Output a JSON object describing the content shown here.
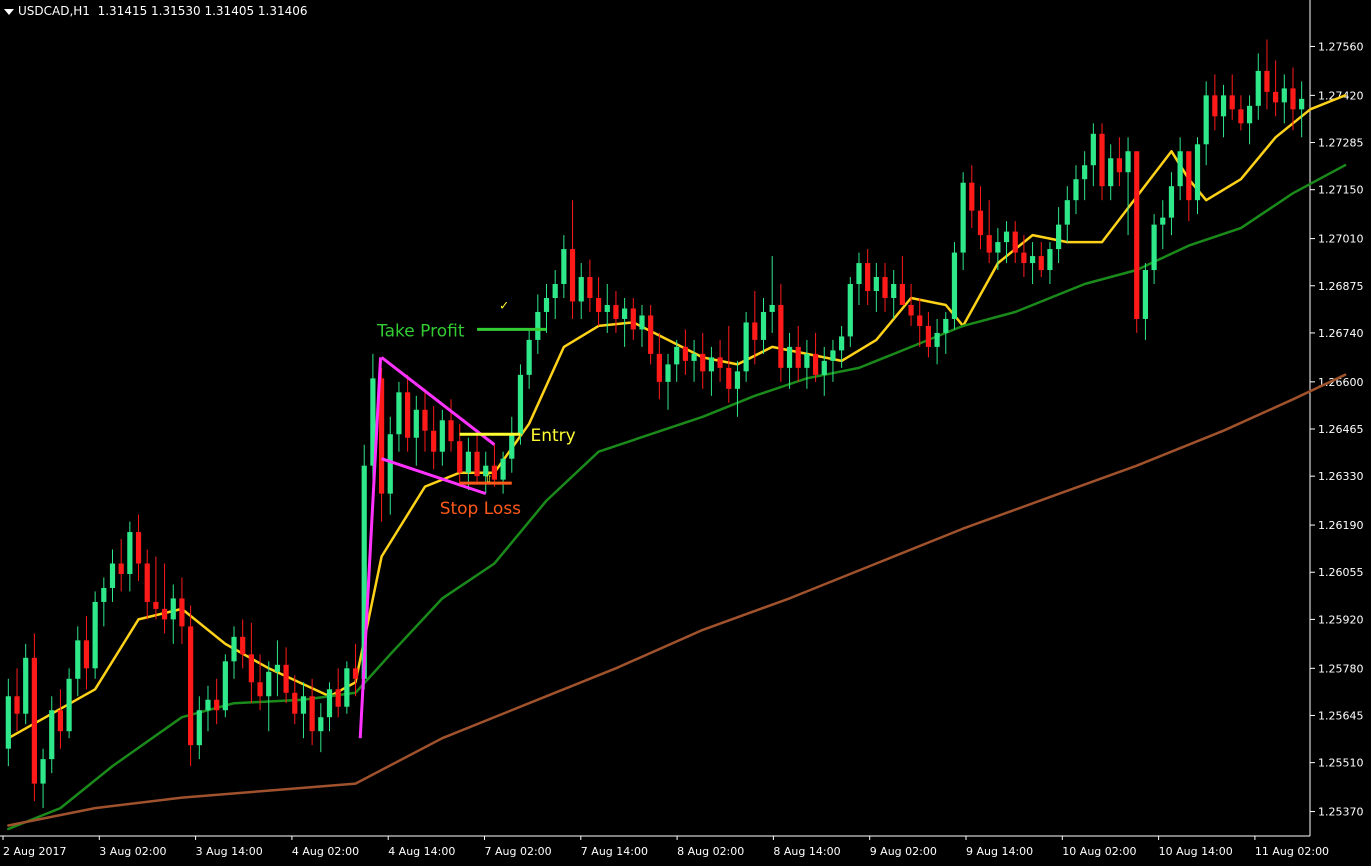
{
  "header": {
    "symbol": "USDCAD,H1",
    "ohlc": "1.31415 1.31530 1.31405 1.31406"
  },
  "colors": {
    "background": "#000000",
    "bull": "#2ee88a",
    "bear": "#ff1a1a",
    "ma_fast": "#ffd21a",
    "ma_mid": "#1a8a1a",
    "ma_slow": "#a0522d",
    "pattern": "#ff33ff",
    "take_profit": "#33cc33",
    "entry": "#ffff33",
    "stop_loss": "#ff5a1a",
    "axis": "#ffffff"
  },
  "annotations": {
    "take_profit_label": "Take Profit",
    "entry_label": "Entry",
    "stop_loss_label": "Stop Loss",
    "check_mark": "✓",
    "arrow_mark": "⇧"
  },
  "chart_data": {
    "type": "candlestick",
    "title": "",
    "ylim": [
      1.253,
      1.2763
    ],
    "y_ticks": [
      "1.27560",
      "1.27420",
      "1.27285",
      "1.27150",
      "1.27010",
      "1.26875",
      "1.26740",
      "1.26600",
      "1.26465",
      "1.26330",
      "1.26190",
      "1.26055",
      "1.25920",
      "1.25780",
      "1.25645",
      "1.25510",
      "1.25370"
    ],
    "x_ticks": [
      "2 Aug 2017",
      "3 Aug 02:00",
      "3 Aug 14:00",
      "4 Aug 02:00",
      "4 Aug 14:00",
      "7 Aug 02:00",
      "7 Aug 14:00",
      "8 Aug 02:00",
      "8 Aug 14:00",
      "9 Aug 02:00",
      "9 Aug 14:00",
      "10 Aug 02:00",
      "10 Aug 14:00",
      "11 Aug 02:00"
    ],
    "candles": [
      [
        1.2555,
        1.2575,
        1.255,
        1.257
      ],
      [
        1.257,
        1.2578,
        1.256,
        1.2565
      ],
      [
        1.2565,
        1.2585,
        1.2562,
        1.2581
      ],
      [
        1.2581,
        1.2588,
        1.254,
        1.2545
      ],
      [
        1.2545,
        1.2555,
        1.2538,
        1.2552
      ],
      [
        1.2552,
        1.257,
        1.2548,
        1.2566
      ],
      [
        1.2566,
        1.2572,
        1.2555,
        1.256
      ],
      [
        1.256,
        1.2578,
        1.2558,
        1.2575
      ],
      [
        1.2575,
        1.259,
        1.257,
        1.2586
      ],
      [
        1.2586,
        1.2593,
        1.2572,
        1.2578
      ],
      [
        1.2578,
        1.26,
        1.2575,
        1.2597
      ],
      [
        1.2597,
        1.2604,
        1.259,
        1.2601
      ],
      [
        1.2601,
        1.2612,
        1.2597,
        1.2608
      ],
      [
        1.2608,
        1.2615,
        1.26,
        1.2605
      ],
      [
        1.2605,
        1.262,
        1.26,
        1.2617
      ],
      [
        1.2617,
        1.2622,
        1.2603,
        1.2608
      ],
      [
        1.2608,
        1.2612,
        1.2592,
        1.2597
      ],
      [
        1.2597,
        1.261,
        1.2592,
        1.2595
      ],
      [
        1.2595,
        1.2608,
        1.2588,
        1.2592
      ],
      [
        1.2592,
        1.2602,
        1.2585,
        1.2598
      ],
      [
        1.2598,
        1.2604,
        1.2585,
        1.259
      ],
      [
        1.259,
        1.2596,
        1.255,
        1.2556
      ],
      [
        1.2556,
        1.257,
        1.2552,
        1.2566
      ],
      [
        1.2566,
        1.2573,
        1.256,
        1.2569
      ],
      [
        1.2569,
        1.2575,
        1.2562,
        1.2566
      ],
      [
        1.2566,
        1.2582,
        1.2564,
        1.258
      ],
      [
        1.258,
        1.259,
        1.2575,
        1.2587
      ],
      [
        1.2587,
        1.2592,
        1.2578,
        1.2582
      ],
      [
        1.2582,
        1.2591,
        1.2568,
        1.2574
      ],
      [
        1.2574,
        1.2582,
        1.2566,
        1.257
      ],
      [
        1.257,
        1.258,
        1.256,
        1.2577
      ],
      [
        1.2577,
        1.2586,
        1.257,
        1.2579
      ],
      [
        1.2579,
        1.2584,
        1.2568,
        1.2571
      ],
      [
        1.2571,
        1.2576,
        1.2562,
        1.2565
      ],
      [
        1.2565,
        1.2574,
        1.2558,
        1.257
      ],
      [
        1.257,
        1.2575,
        1.2556,
        1.256
      ],
      [
        1.256,
        1.2568,
        1.2554,
        1.2564
      ],
      [
        1.2564,
        1.2574,
        1.256,
        1.2572
      ],
      [
        1.2572,
        1.2578,
        1.2564,
        1.2567
      ],
      [
        1.2567,
        1.258,
        1.2565,
        1.2578
      ],
      [
        1.2578,
        1.2585,
        1.257,
        1.2575
      ],
      [
        1.2575,
        1.2642,
        1.2572,
        1.2636
      ],
      [
        1.2636,
        1.2668,
        1.2632,
        1.2661
      ],
      [
        1.2661,
        1.2664,
        1.262,
        1.2628
      ],
      [
        1.2628,
        1.265,
        1.2622,
        1.2645
      ],
      [
        1.2645,
        1.266,
        1.264,
        1.2657
      ],
      [
        1.2657,
        1.2662,
        1.264,
        1.2644
      ],
      [
        1.2644,
        1.2656,
        1.2636,
        1.2652
      ],
      [
        1.2652,
        1.2658,
        1.264,
        1.2646
      ],
      [
        1.2646,
        1.2653,
        1.2635,
        1.264
      ],
      [
        1.264,
        1.2652,
        1.2636,
        1.2649
      ],
      [
        1.2649,
        1.2655,
        1.264,
        1.2643
      ],
      [
        1.2643,
        1.2648,
        1.263,
        1.2634
      ],
      [
        1.2634,
        1.2644,
        1.2629,
        1.264
      ],
      [
        1.264,
        1.2646,
        1.2631,
        1.2633
      ],
      [
        1.2633,
        1.264,
        1.2628,
        1.2636
      ],
      [
        1.2636,
        1.2642,
        1.263,
        1.2632
      ],
      [
        1.2632,
        1.264,
        1.2628,
        1.2638
      ],
      [
        1.2638,
        1.265,
        1.2634,
        1.2645
      ],
      [
        1.2645,
        1.2665,
        1.2642,
        1.2662
      ],
      [
        1.2662,
        1.2675,
        1.2658,
        1.2672
      ],
      [
        1.2672,
        1.2685,
        1.2668,
        1.268
      ],
      [
        1.268,
        1.2688,
        1.2674,
        1.2684
      ],
      [
        1.2684,
        1.2692,
        1.2678,
        1.2688
      ],
      [
        1.2688,
        1.2702,
        1.2684,
        1.2698
      ],
      [
        1.2698,
        1.2712,
        1.2678,
        1.2683
      ],
      [
        1.2683,
        1.2694,
        1.2678,
        1.269
      ],
      [
        1.269,
        1.2695,
        1.268,
        1.2684
      ],
      [
        1.2684,
        1.269,
        1.2676,
        1.268
      ],
      [
        1.268,
        1.2688,
        1.2674,
        1.2682
      ],
      [
        1.2682,
        1.2686,
        1.2674,
        1.2678
      ],
      [
        1.2678,
        1.2684,
        1.267,
        1.2681
      ],
      [
        1.2681,
        1.2684,
        1.2672,
        1.2675
      ],
      [
        1.2675,
        1.2682,
        1.267,
        1.2679
      ],
      [
        1.2679,
        1.2682,
        1.2665,
        1.2668
      ],
      [
        1.2668,
        1.2674,
        1.2655,
        1.266
      ],
      [
        1.266,
        1.2668,
        1.2652,
        1.2665
      ],
      [
        1.2665,
        1.2672,
        1.266,
        1.267
      ],
      [
        1.267,
        1.2675,
        1.2662,
        1.2666
      ],
      [
        1.2666,
        1.2672,
        1.266,
        1.2668
      ],
      [
        1.2668,
        1.2674,
        1.2658,
        1.2663
      ],
      [
        1.2663,
        1.267,
        1.2656,
        1.2667
      ],
      [
        1.2667,
        1.2672,
        1.266,
        1.2664
      ],
      [
        1.2664,
        1.2676,
        1.2654,
        1.2658
      ],
      [
        1.2658,
        1.2666,
        1.265,
        1.2663
      ],
      [
        1.2663,
        1.268,
        1.266,
        1.2677
      ],
      [
        1.2677,
        1.2686,
        1.2665,
        1.2672
      ],
      [
        1.2672,
        1.2684,
        1.2668,
        1.268
      ],
      [
        1.268,
        1.2696,
        1.2674,
        1.2682
      ],
      [
        1.2682,
        1.2688,
        1.266,
        1.2664
      ],
      [
        1.2664,
        1.2674,
        1.2658,
        1.267
      ],
      [
        1.267,
        1.2676,
        1.266,
        1.2664
      ],
      [
        1.2664,
        1.2672,
        1.2658,
        1.2668
      ],
      [
        1.2668,
        1.2674,
        1.266,
        1.2662
      ],
      [
        1.2662,
        1.267,
        1.2656,
        1.2666
      ],
      [
        1.2666,
        1.2672,
        1.266,
        1.2669
      ],
      [
        1.2669,
        1.2676,
        1.2664,
        1.2673
      ],
      [
        1.2673,
        1.269,
        1.267,
        1.2688
      ],
      [
        1.2688,
        1.2697,
        1.2682,
        1.2694
      ],
      [
        1.2694,
        1.2698,
        1.2682,
        1.2686
      ],
      [
        1.2686,
        1.2694,
        1.268,
        1.269
      ],
      [
        1.269,
        1.2694,
        1.268,
        1.2684
      ],
      [
        1.2684,
        1.2692,
        1.2678,
        1.2688
      ],
      [
        1.2688,
        1.2696,
        1.2682,
        1.2682
      ],
      [
        1.2682,
        1.2688,
        1.2676,
        1.2679
      ],
      [
        1.2679,
        1.2684,
        1.267,
        1.2676
      ],
      [
        1.2676,
        1.268,
        1.2667,
        1.267
      ],
      [
        1.267,
        1.2678,
        1.2665,
        1.2674
      ],
      [
        1.2674,
        1.268,
        1.2668,
        1.2678
      ],
      [
        1.2678,
        1.27,
        1.2675,
        1.2697
      ],
      [
        1.2697,
        1.272,
        1.2692,
        1.2717
      ],
      [
        1.2717,
        1.2722,
        1.2704,
        1.2709
      ],
      [
        1.2709,
        1.2716,
        1.2698,
        1.2702
      ],
      [
        1.2702,
        1.2712,
        1.2694,
        1.2697
      ],
      [
        1.2697,
        1.2704,
        1.2692,
        1.27
      ],
      [
        1.27,
        1.2706,
        1.2694,
        1.2703
      ],
      [
        1.2703,
        1.2706,
        1.2694,
        1.2697
      ],
      [
        1.2697,
        1.2702,
        1.269,
        1.2694
      ],
      [
        1.2694,
        1.27,
        1.2688,
        1.2696
      ],
      [
        1.2696,
        1.27,
        1.269,
        1.2692
      ],
      [
        1.2692,
        1.27,
        1.2688,
        1.2698
      ],
      [
        1.2698,
        1.271,
        1.2694,
        1.2705
      ],
      [
        1.2705,
        1.2716,
        1.27,
        1.2712
      ],
      [
        1.2712,
        1.2722,
        1.2708,
        1.2718
      ],
      [
        1.2718,
        1.2726,
        1.2712,
        1.2722
      ],
      [
        1.2722,
        1.2734,
        1.2716,
        1.2731
      ],
      [
        1.2731,
        1.2734,
        1.2712,
        1.2716
      ],
      [
        1.2716,
        1.2728,
        1.2712,
        1.2724
      ],
      [
        1.2724,
        1.273,
        1.2716,
        1.272
      ],
      [
        1.272,
        1.273,
        1.2702,
        1.2726
      ],
      [
        1.2726,
        1.2726,
        1.2674,
        1.2678
      ],
      [
        1.2678,
        1.2694,
        1.2672,
        1.2692
      ],
      [
        1.2692,
        1.2708,
        1.2688,
        1.2705
      ],
      [
        1.2705,
        1.2712,
        1.2698,
        1.2707
      ],
      [
        1.2707,
        1.272,
        1.2702,
        1.2716
      ],
      [
        1.2716,
        1.273,
        1.2712,
        1.2726
      ],
      [
        1.2726,
        1.2724,
        1.2706,
        1.2712
      ],
      [
        1.2712,
        1.273,
        1.2708,
        1.2728
      ],
      [
        1.2728,
        1.2746,
        1.2722,
        1.2742
      ],
      [
        1.2742,
        1.2748,
        1.2732,
        1.2736
      ],
      [
        1.2736,
        1.2745,
        1.273,
        1.2742
      ],
      [
        1.2742,
        1.2748,
        1.2735,
        1.2738
      ],
      [
        1.2738,
        1.2742,
        1.2732,
        1.2734
      ],
      [
        1.2734,
        1.2742,
        1.2728,
        1.2739
      ],
      [
        1.2739,
        1.2754,
        1.2735,
        1.2749
      ],
      [
        1.2749,
        1.2758,
        1.2738,
        1.2743
      ],
      [
        1.2743,
        1.2752,
        1.2736,
        1.274
      ],
      [
        1.274,
        1.2748,
        1.2734,
        1.2744
      ],
      [
        1.2744,
        1.275,
        1.2732,
        1.2738
      ],
      [
        1.2738,
        1.2746,
        1.273,
        1.2741
      ]
    ],
    "moving_averages": [
      {
        "color_key": "ma_fast",
        "values": [
          [
            0,
            1.2558
          ],
          [
            10,
            1.2572
          ],
          [
            15,
            1.2592
          ],
          [
            20,
            1.2595
          ],
          [
            25,
            1.2585
          ],
          [
            30,
            1.2578
          ],
          [
            37,
            1.257
          ],
          [
            40,
            1.2574
          ],
          [
            43,
            1.261
          ],
          [
            48,
            1.263
          ],
          [
            52,
            1.2634
          ],
          [
            56,
            1.2634
          ],
          [
            60,
            1.2648
          ],
          [
            64,
            1.267
          ],
          [
            68,
            1.2676
          ],
          [
            72,
            1.2677
          ],
          [
            76,
            1.2672
          ],
          [
            80,
            1.2667
          ],
          [
            84,
            1.2665
          ],
          [
            88,
            1.267
          ],
          [
            92,
            1.2668
          ],
          [
            96,
            1.2666
          ],
          [
            100,
            1.2672
          ],
          [
            104,
            1.2684
          ],
          [
            108,
            1.2682
          ],
          [
            110,
            1.2676
          ],
          [
            114,
            1.2694
          ],
          [
            118,
            1.2702
          ],
          [
            122,
            1.27
          ],
          [
            126,
            1.27
          ],
          [
            130,
            1.2713
          ],
          [
            134,
            1.2726
          ],
          [
            136,
            1.2718
          ],
          [
            138,
            1.2712
          ],
          [
            142,
            1.2718
          ],
          [
            146,
            1.273
          ],
          [
            150,
            1.2738
          ],
          [
            154,
            1.2742
          ]
        ]
      },
      {
        "color_key": "ma_mid",
        "values": [
          [
            0,
            1.2532
          ],
          [
            6,
            1.2538
          ],
          [
            12,
            1.255
          ],
          [
            20,
            1.2564
          ],
          [
            26,
            1.2568
          ],
          [
            34,
            1.2569
          ],
          [
            40,
            1.2571
          ],
          [
            44,
            1.2582
          ],
          [
            50,
            1.2598
          ],
          [
            56,
            1.2608
          ],
          [
            62,
            1.2626
          ],
          [
            68,
            1.264
          ],
          [
            74,
            1.2645
          ],
          [
            80,
            1.265
          ],
          [
            86,
            1.2656
          ],
          [
            92,
            1.2661
          ],
          [
            98,
            1.2664
          ],
          [
            104,
            1.267
          ],
          [
            110,
            1.2676
          ],
          [
            116,
            1.268
          ],
          [
            124,
            1.2688
          ],
          [
            130,
            1.2692
          ],
          [
            136,
            1.2699
          ],
          [
            142,
            1.2704
          ],
          [
            148,
            1.2714
          ],
          [
            154,
            1.2722
          ]
        ]
      },
      {
        "color_key": "ma_slow",
        "values": [
          [
            0,
            1.2533
          ],
          [
            10,
            1.2538
          ],
          [
            20,
            1.2541
          ],
          [
            30,
            1.2543
          ],
          [
            40,
            1.2545
          ],
          [
            50,
            1.2558
          ],
          [
            60,
            1.2568
          ],
          [
            70,
            1.2578
          ],
          [
            80,
            1.2589
          ],
          [
            90,
            1.2598
          ],
          [
            100,
            1.2608
          ],
          [
            110,
            1.2618
          ],
          [
            120,
            1.2627
          ],
          [
            130,
            1.2636
          ],
          [
            140,
            1.2646
          ],
          [
            148,
            1.2655
          ],
          [
            154,
            1.2662
          ]
        ]
      }
    ],
    "levels": {
      "take_profit": 1.2675,
      "entry": 1.2645,
      "stop_loss": 1.2631
    },
    "pattern_points": {
      "apex_top": [
        43,
        1.2667
      ],
      "upper_end": [
        56,
        1.2642
      ],
      "lower_start": [
        43,
        1.2638
      ],
      "lower_end": [
        55,
        1.2628
      ],
      "pole_bottom": [
        41,
        1.2558
      ]
    }
  }
}
